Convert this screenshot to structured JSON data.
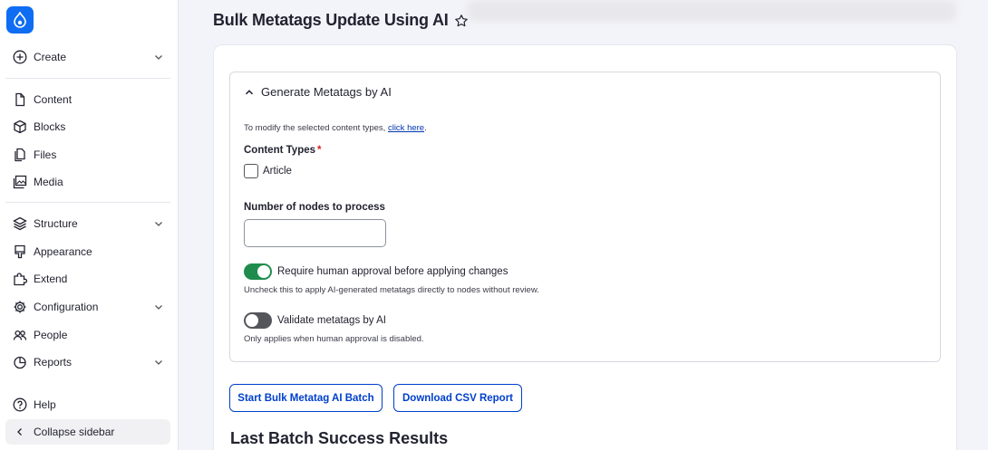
{
  "sidebar": {
    "logo_icon": "drupal-drop-icon",
    "items": [
      {
        "label": "Create",
        "icon": "plus-circle-icon",
        "has_submenu": true
      },
      {
        "label": "Content",
        "icon": "document-icon",
        "has_submenu": false
      },
      {
        "label": "Blocks",
        "icon": "cube-icon",
        "has_submenu": false
      },
      {
        "label": "Files",
        "icon": "files-icon",
        "has_submenu": false
      },
      {
        "label": "Media",
        "icon": "image-icon",
        "has_submenu": false
      },
      {
        "label": "Structure",
        "icon": "layers-icon",
        "has_submenu": true
      },
      {
        "label": "Appearance",
        "icon": "paint-brush-icon",
        "has_submenu": false
      },
      {
        "label": "Extend",
        "icon": "puzzle-icon",
        "has_submenu": false
      },
      {
        "label": "Configuration",
        "icon": "gear-icon",
        "has_submenu": true
      },
      {
        "label": "People",
        "icon": "people-icon",
        "has_submenu": false
      },
      {
        "label": "Reports",
        "icon": "pie-chart-icon",
        "has_submenu": true
      }
    ],
    "help": {
      "label": "Help",
      "icon": "question-circle-icon"
    },
    "collapse": {
      "label": "Collapse sidebar",
      "icon": "chevron-left-icon"
    }
  },
  "page": {
    "title": "Bulk Metatags Update Using AI",
    "favorite_icon": "star-outline-icon"
  },
  "form": {
    "section_title": "Generate Metatags by AI",
    "modify_hint_prefix": "To modify the selected content types, ",
    "modify_hint_link": "click here",
    "modify_hint_suffix": ".",
    "content_types_label": "Content Types",
    "required_marker": "*",
    "content_type_options": [
      {
        "label": "Article",
        "checked": false
      }
    ],
    "nodes_label": "Number of nodes to process",
    "nodes_value": "",
    "require_approval": {
      "label": "Require human approval before applying changes",
      "description": "Uncheck this to apply AI-generated metatags directly to nodes without review.",
      "enabled": true
    },
    "validate_metatags": {
      "label": "Validate metatags by AI",
      "description": "Only applies when human approval is disabled.",
      "enabled": false
    }
  },
  "actions": {
    "start_batch_label": "Start Bulk Metatag AI Batch",
    "download_report_label": "Download CSV Report"
  },
  "results": {
    "title": "Last Batch Success Results"
  },
  "colors": {
    "brand": "#0e6df2",
    "link": "#0036b1",
    "button": "#003ecc",
    "toggle_on": "#1f8c4e",
    "toggle_off": "#55565b",
    "required": "#d72222"
  }
}
